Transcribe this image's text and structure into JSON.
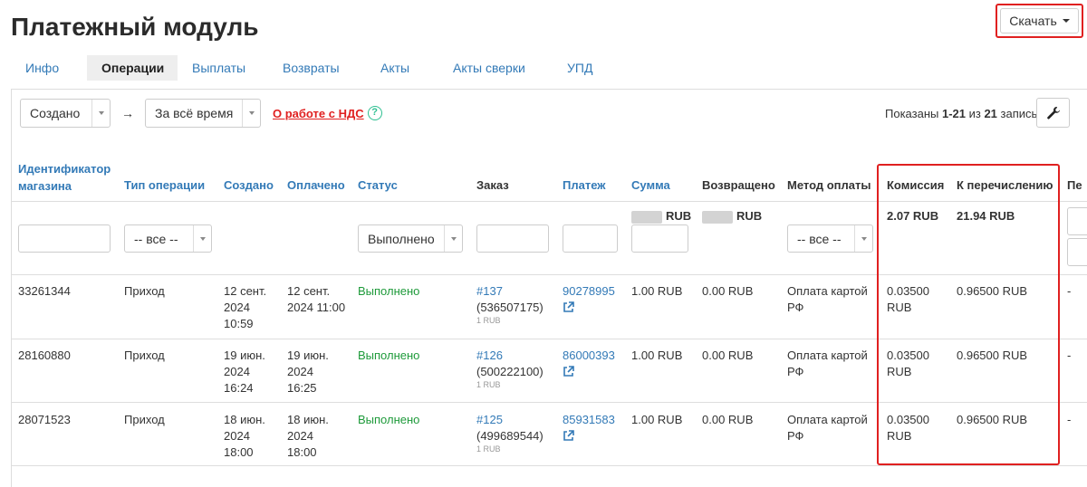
{
  "page_title": "Платежный модуль",
  "download_label": "Скачать",
  "tabs": [
    {
      "label": "Инфо",
      "active": false
    },
    {
      "label": "Операции",
      "active": true
    },
    {
      "label": "Выплаты",
      "active": false
    },
    {
      "label": "Возвраты",
      "active": false
    },
    {
      "label": "Акты",
      "active": false
    },
    {
      "label": "Акты сверки",
      "active": false
    },
    {
      "label": "УПД",
      "active": false
    }
  ],
  "filters": {
    "date_field": "Создано",
    "arrow": "→",
    "period": "За всё время",
    "vat_link": "О работе с НДС",
    "help_glyph": "?"
  },
  "summary": {
    "prefix": "Показаны ",
    "range": "1-21",
    "middle": " из ",
    "total": "21",
    "suffix": " запись."
  },
  "columns": {
    "shop_id": "Идентификатор магазина",
    "op_type": "Тип операции",
    "created": "Создано",
    "paid": "Оплачено",
    "status": "Статус",
    "order": "Заказ",
    "payment": "Платеж",
    "amount": "Сумма",
    "refunded": "Возвращено",
    "method": "Метод оплаты",
    "commission": "Комиссия",
    "to_transfer": "К перечислению",
    "extra": "Пе"
  },
  "filter_row": {
    "op_type_select": "-- все --",
    "status_select": "Выполнено",
    "amount_total_currency": "RUB",
    "refunded_total_currency": "RUB",
    "method_select": "-- все --",
    "commission_total": "2.07 RUB",
    "to_transfer_total": "21.94 RUB"
  },
  "rows": [
    {
      "shop_id": "33261344",
      "op_type": "Приход",
      "created": [
        "12 сент.",
        "2024",
        "10:59"
      ],
      "paid": [
        "12 сент.",
        "2024 11:00"
      ],
      "status": "Выполнено",
      "order": "#137",
      "order_sub": "(536507175)",
      "order_amount": "1 RUB",
      "payment": "90278995",
      "amount": "1.00 RUB",
      "refunded": "0.00 RUB",
      "method": [
        "Оплата картой",
        "РФ"
      ],
      "commission": [
        "0.03500",
        "RUB"
      ],
      "to_transfer": "0.96500 RUB",
      "extra": "-"
    },
    {
      "shop_id": "28160880",
      "op_type": "Приход",
      "created": [
        "19 июн.",
        "2024",
        "16:24"
      ],
      "paid": [
        "19 июн.",
        "2024",
        "16:25"
      ],
      "status": "Выполнено",
      "order": "#126",
      "order_sub": "(500222100)",
      "order_amount": "1 RUB",
      "payment": "86000393",
      "amount": "1.00 RUB",
      "refunded": "0.00 RUB",
      "method": [
        "Оплата картой",
        "РФ"
      ],
      "commission": [
        "0.03500",
        "RUB"
      ],
      "to_transfer": "0.96500 RUB",
      "extra": "-"
    },
    {
      "shop_id": "28071523",
      "op_type": "Приход",
      "created": [
        "18 июн.",
        "2024",
        "18:00"
      ],
      "paid": [
        "18 июн.",
        "2024",
        "18:00"
      ],
      "status": "Выполнено",
      "order": "#125",
      "order_sub": "(499689544)",
      "order_amount": "1 RUB",
      "payment": "85931583",
      "amount": "1.00 RUB",
      "refunded": "0.00 RUB",
      "method": [
        "Оплата картой",
        "РФ"
      ],
      "commission": [
        "0.03500",
        "RUB"
      ],
      "to_transfer": "0.96500 RUB",
      "extra": "-"
    }
  ],
  "colors": {
    "accent": "#337ab7",
    "status_ok": "#1e9a3a",
    "highlight": "#e02020"
  },
  "icons": {
    "wrench": "wrench-icon",
    "external": "external-link-icon",
    "help": "help-circle-icon"
  }
}
